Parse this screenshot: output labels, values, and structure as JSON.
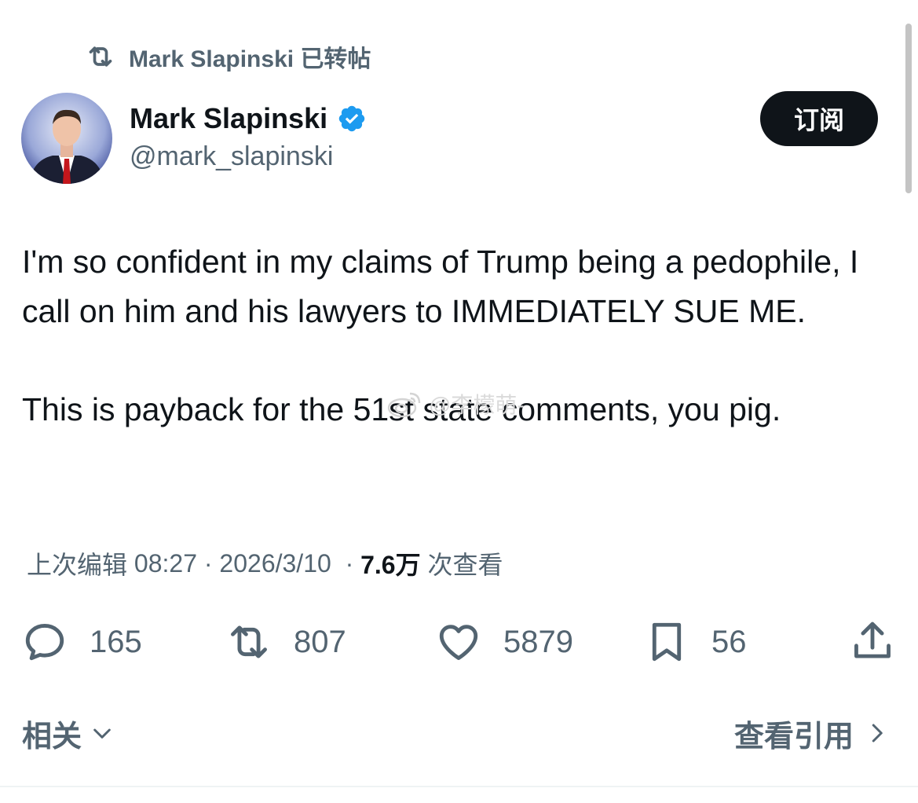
{
  "repost_line": {
    "name": "Mark Slapinski",
    "suffix": "已转帖"
  },
  "author": {
    "name": "Mark Slapinski",
    "handle": "@mark_slapinski",
    "verified": true
  },
  "subscribe_label": "订阅",
  "tweet": {
    "paragraph1": "I'm so confident in my claims of Trump being a pedophile, I call on him and his lawyers to IMMEDIATELY SUE ME.",
    "paragraph2": "This is payback for the 51st state comments, you pig."
  },
  "watermark": "@李檬萌-",
  "meta": {
    "edited_label": "上次编辑",
    "time": "08:27",
    "date": "2026/3/10",
    "views_count": "7.6万",
    "views_label": "次查看"
  },
  "actions": {
    "replies": "165",
    "reposts": "807",
    "likes": "5879",
    "bookmarks": "56"
  },
  "footer": {
    "related_label": "相关",
    "view_quotes_label": "查看引用"
  },
  "colors": {
    "verified_blue": "#1d9bf0",
    "secondary_text": "#536471",
    "primary_text": "#0f1419"
  },
  "icons": [
    "repost-icon",
    "verified-icon",
    "reply-icon",
    "like-icon",
    "bookmark-icon",
    "share-icon",
    "chevron-down-icon",
    "chevron-right-icon",
    "weibo-icon"
  ]
}
